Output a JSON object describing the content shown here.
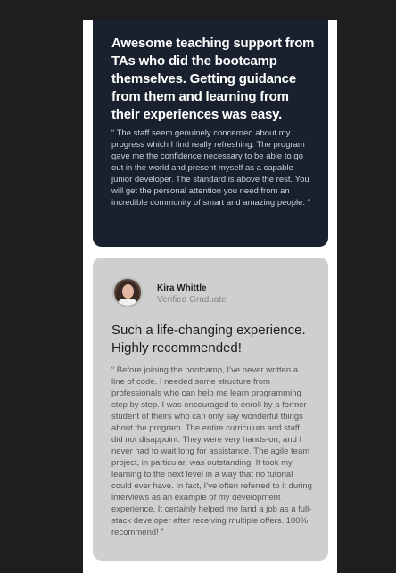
{
  "testimonials": [
    {
      "headline": "Awesome teaching support from TAs who did the bootcamp themselves. Getting guidance from them and learning from their experiences was easy.",
      "body": "“ The staff seem genuinely concerned about my progress which I find really refreshing. The program gave me the confidence necessary to be able to go out in the world and present myself as a capable junior developer. The standard is above the rest. You will get the personal attention you need from an incredible community of smart and amazing people. ”"
    },
    {
      "name": "Kira Whittle",
      "role": "Verified Graduate",
      "headline": "Such a life-changing experience. Highly recommended!",
      "body": "“ Before joining the bootcamp, I’ve never written a line of code. I needed some structure from professionals who can help me learn programming step by step. I was encouraged to enroll by a former student of theirs who can only say wonderful things about the program. The entire curriculum and staff did not disappoint. They were very hands-on, and I never had to wait long for assistance. The agile team project, in particular, was outstanding. It took my learning to the next level in a way that no tutorial could ever have. In fact, I’ve often referred to it during interviews as an example of my development experience. It certainly helped me land a job as a full-stack developer after receiving multiple offers. 100% recommend! ”"
    }
  ],
  "colors": {
    "background": "#1e1e1e",
    "page": "#ffffff",
    "dark_card": "#19212e",
    "light_card": "#cfcfcf",
    "accent": "#a56da8"
  }
}
